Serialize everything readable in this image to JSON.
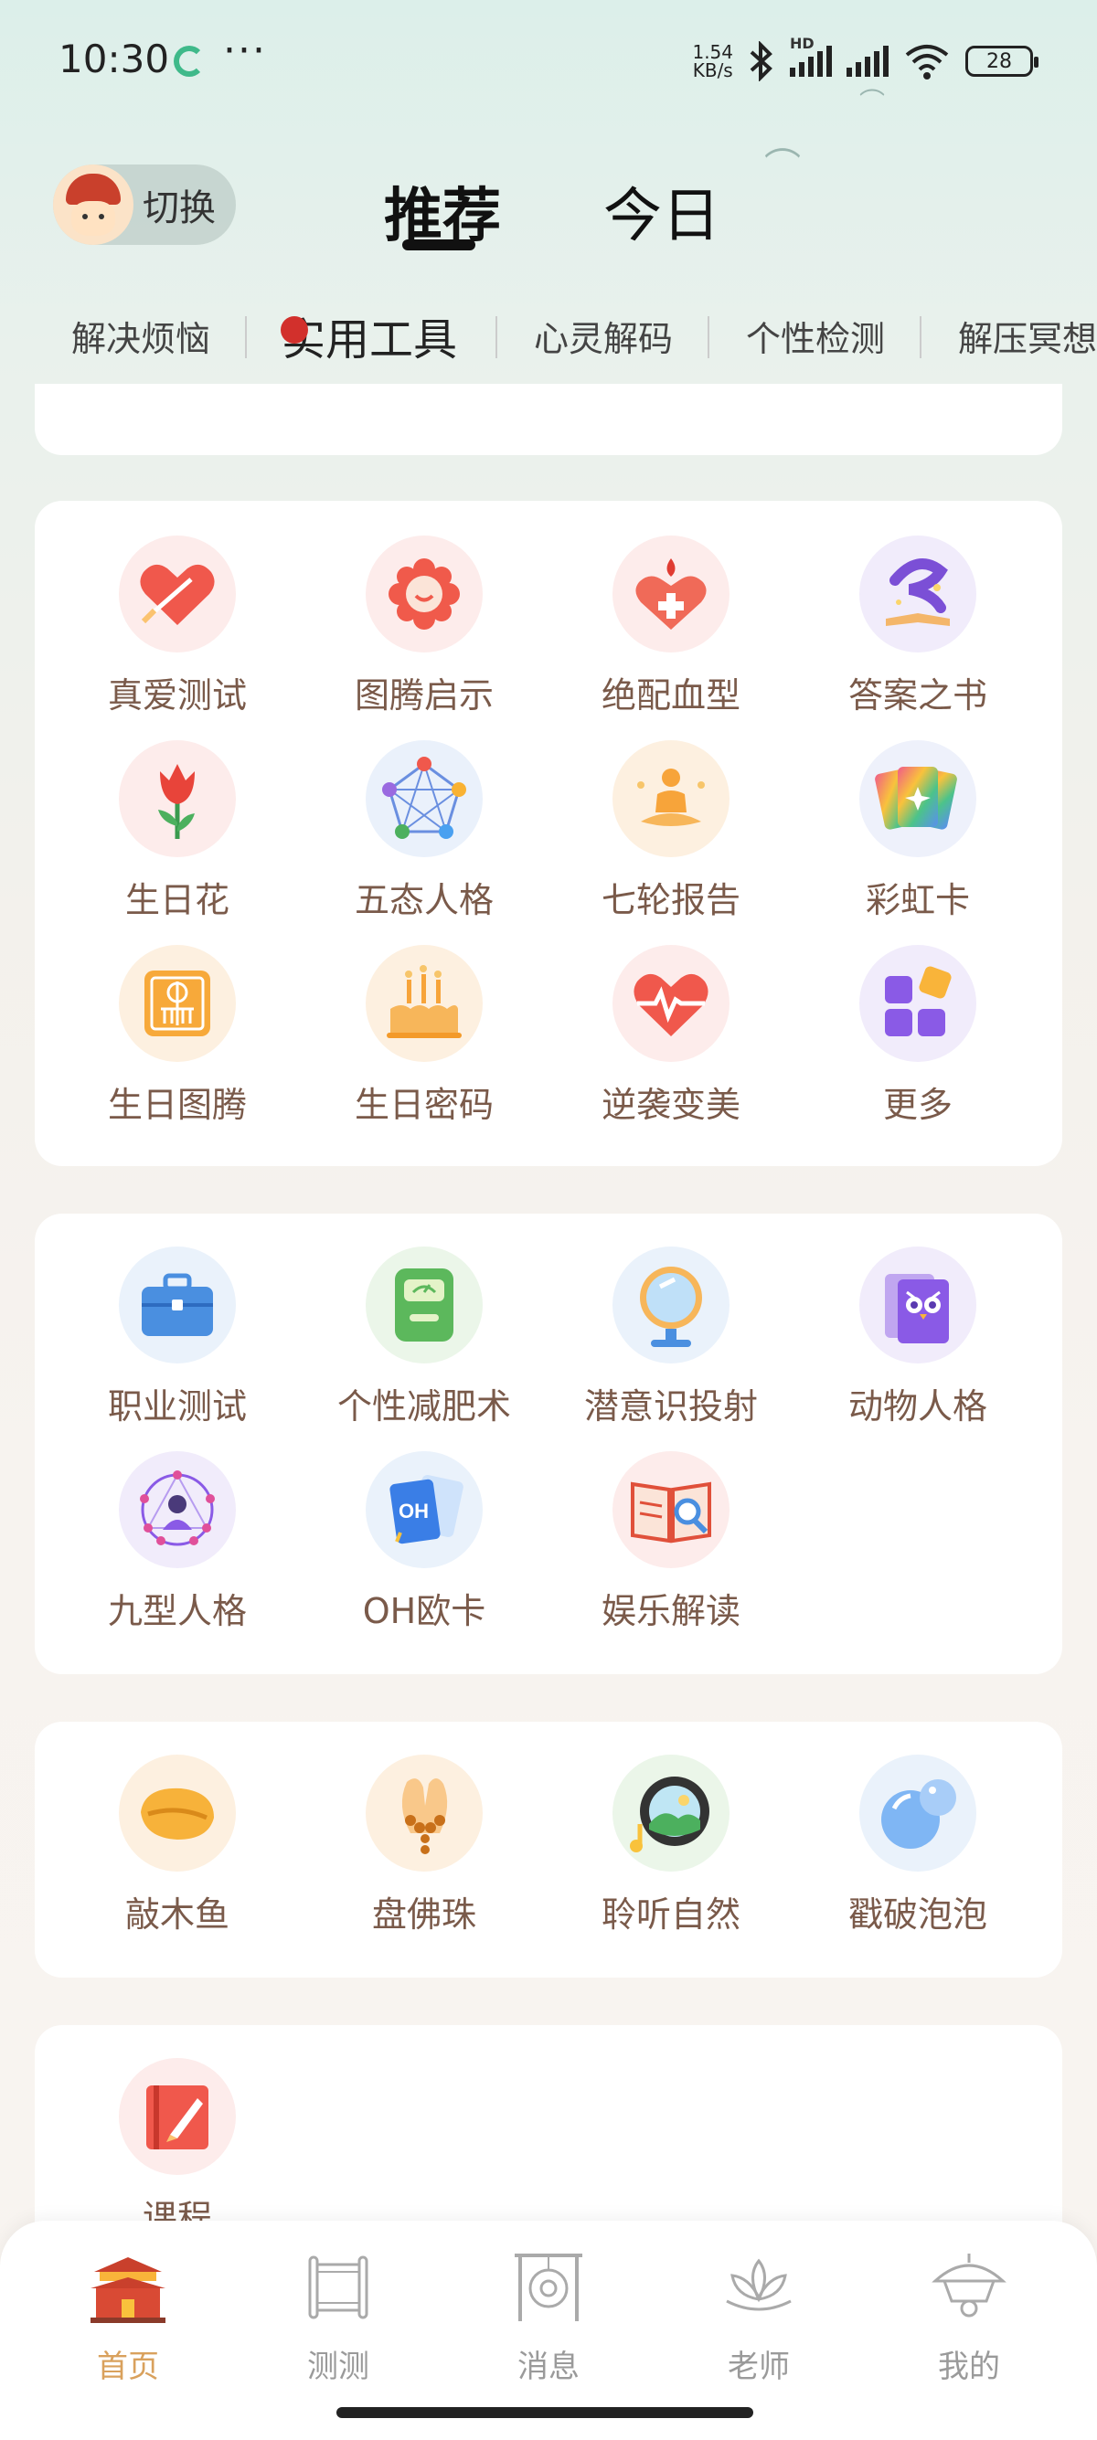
{
  "status_bar": {
    "time": "10:30",
    "more": "···",
    "net_speed_value": "1.54",
    "net_speed_unit": "KB/s",
    "network_tag": "HD",
    "battery": "28"
  },
  "header": {
    "switch_label": "切换",
    "tabs": [
      "推荐",
      "今日"
    ]
  },
  "category_tabs": [
    "解决烦恼",
    "实用工具",
    "心灵解码",
    "个性检测",
    "解压冥想"
  ],
  "category_active_index": 1,
  "card1_items": [
    {
      "label": "真爱测试",
      "icon": "heart-arrow-icon"
    },
    {
      "label": "图腾启示",
      "icon": "totem-flower-icon"
    },
    {
      "label": "绝配血型",
      "icon": "blood-heart-icon"
    },
    {
      "label": "答案之书",
      "icon": "answer-book-icon"
    },
    {
      "label": "生日花",
      "icon": "tulip-icon"
    },
    {
      "label": "五态人格",
      "icon": "pentagon-network-icon"
    },
    {
      "label": "七轮报告",
      "icon": "chakra-meditation-icon"
    },
    {
      "label": "彩虹卡",
      "icon": "rainbow-cards-icon"
    },
    {
      "label": "生日图腾",
      "icon": "birthday-totem-icon"
    },
    {
      "label": "生日密码",
      "icon": "birthday-cake-icon"
    },
    {
      "label": "逆袭变美",
      "icon": "heartbeat-icon"
    },
    {
      "label": "更多",
      "icon": "more-grid-icon"
    }
  ],
  "card2_items": [
    {
      "label": "职业测试",
      "icon": "briefcase-icon"
    },
    {
      "label": "个性减肥术",
      "icon": "scale-icon"
    },
    {
      "label": "潜意识投射",
      "icon": "mirror-icon"
    },
    {
      "label": "动物人格",
      "icon": "owl-card-icon"
    },
    {
      "label": "九型人格",
      "icon": "enneagram-icon"
    },
    {
      "label": "OH欧卡",
      "icon": "oh-card-icon",
      "badge": "OH"
    },
    {
      "label": "娱乐解读",
      "icon": "book-search-icon"
    }
  ],
  "card3_items": [
    {
      "label": "敲木鱼",
      "icon": "wooden-fish-icon"
    },
    {
      "label": "盘佛珠",
      "icon": "prayer-beads-icon"
    },
    {
      "label": "聆听自然",
      "icon": "nature-sound-icon"
    },
    {
      "label": "戳破泡泡",
      "icon": "bubble-icon"
    }
  ],
  "card4_items": [
    {
      "label": "课程",
      "icon": "course-book-icon"
    }
  ],
  "bottom_nav": [
    {
      "label": "首页",
      "icon": "palace-icon",
      "active": true
    },
    {
      "label": "测测",
      "icon": "scroll-icon",
      "active": false
    },
    {
      "label": "消息",
      "icon": "gong-icon",
      "active": false
    },
    {
      "label": "老师",
      "icon": "lotus-icon",
      "active": false
    },
    {
      "label": "我的",
      "icon": "pavilion-icon",
      "active": false
    }
  ],
  "colors": {
    "label_brown": "#7a5a4a",
    "nav_active": "#d9a15d",
    "nav_inactive": "#9a9a9a",
    "badge_red": "#d2302c"
  }
}
